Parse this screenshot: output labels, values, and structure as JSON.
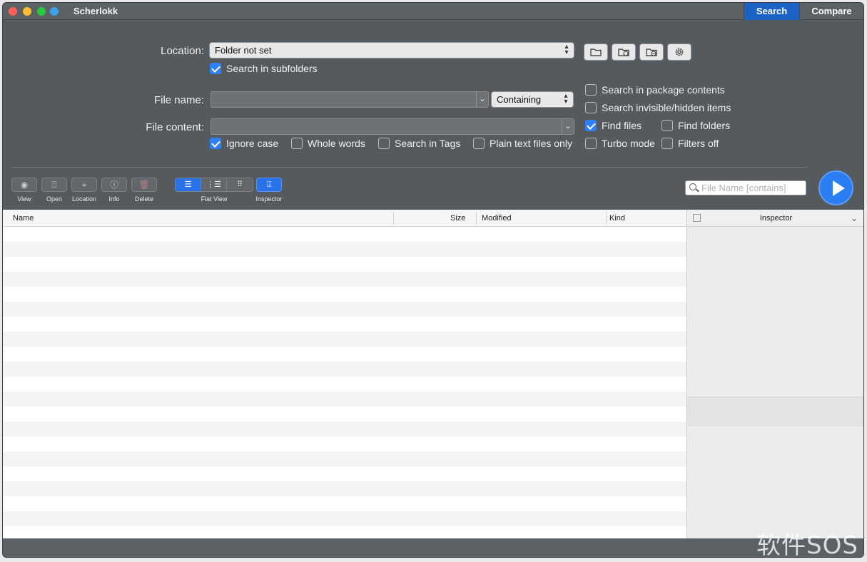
{
  "window": {
    "title": "Scherlokk",
    "tabs": [
      "Search",
      "Compare"
    ]
  },
  "form": {
    "location_label": "Location:",
    "location_value": "Folder not set",
    "search_subfolders": {
      "label": "Search in subfolders",
      "checked": true
    },
    "file_name_label": "File name:",
    "file_name_value": "",
    "match_mode": "Containing",
    "file_content_label": "File content:",
    "file_content_value": "",
    "content_options": [
      {
        "label": "Ignore case",
        "checked": true
      },
      {
        "label": "Whole words",
        "checked": false
      },
      {
        "label": "Search in Tags",
        "checked": false
      },
      {
        "label": "Plain text files only",
        "checked": false
      }
    ],
    "right_options": [
      {
        "label": "Search in package contents",
        "checked": false
      },
      {
        "label": "Search invisible/hidden items",
        "checked": false
      },
      {
        "label": "Find files",
        "checked": true
      },
      {
        "label": "Find folders",
        "checked": false
      },
      {
        "label": "Turbo mode",
        "checked": false
      },
      {
        "label": "Filters off",
        "checked": false
      }
    ]
  },
  "toolbar": {
    "view": "View",
    "open": "Open",
    "location": "Location",
    "info": "Info",
    "delete": "Delete",
    "flat_view": "Flat View",
    "inspector": "Inspector",
    "filter_placeholder": "File Name [contains]"
  },
  "results": {
    "columns": [
      "Name",
      "Size",
      "Modified",
      "Kind"
    ]
  },
  "inspector_panel": {
    "title": "Inspector"
  },
  "watermark": "软件SOS"
}
